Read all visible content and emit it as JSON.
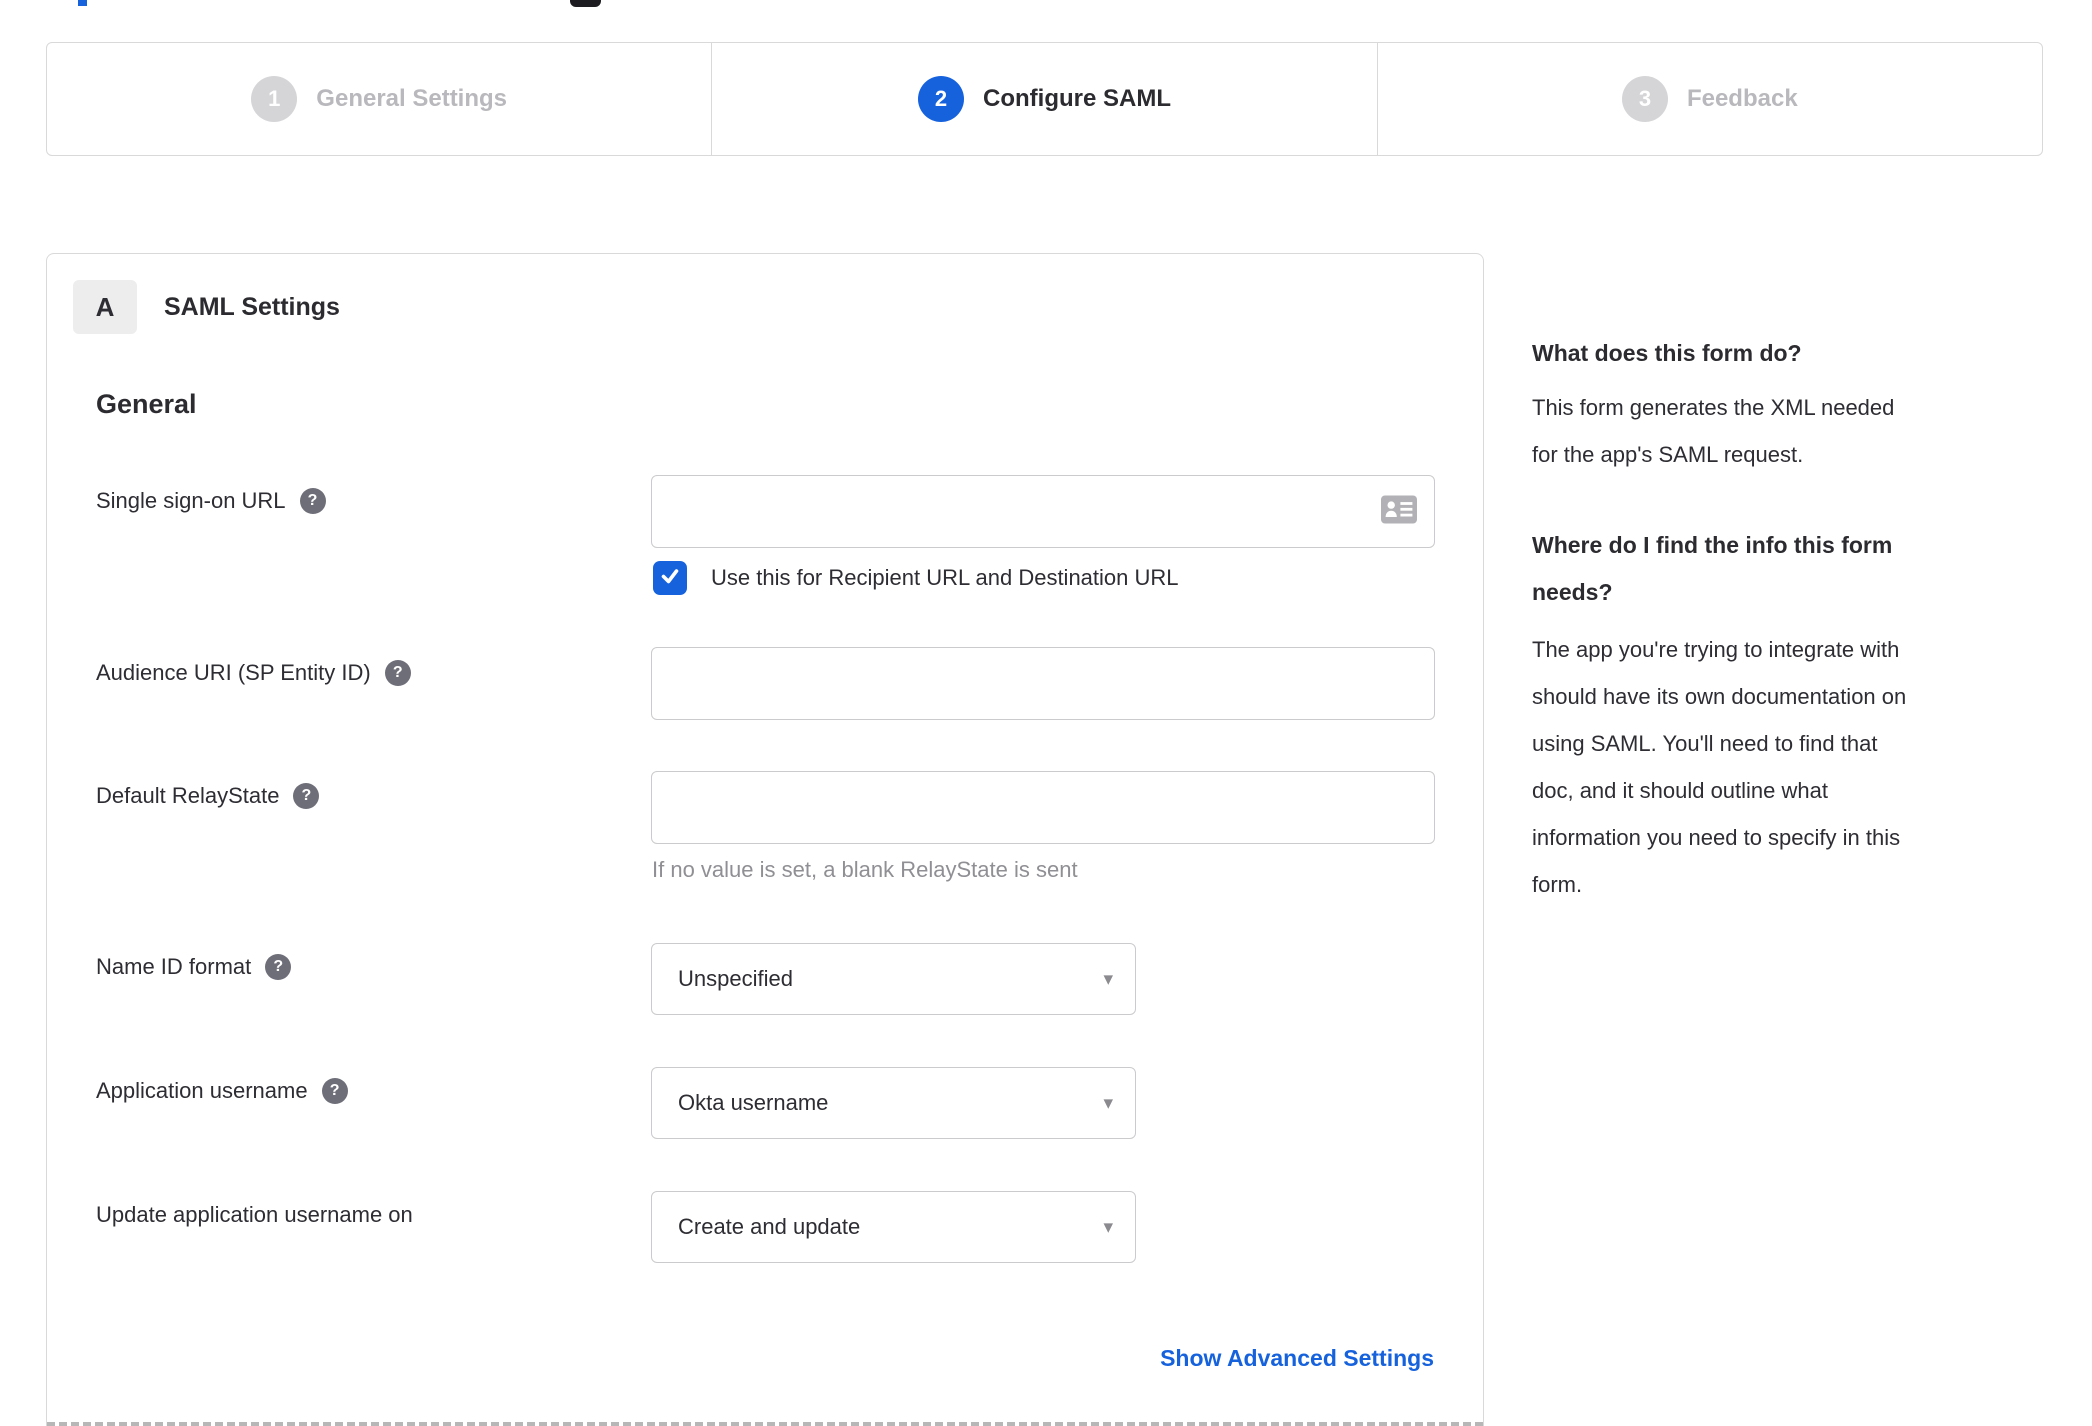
{
  "colors": {
    "accent_blue": "#1662dd",
    "link_blue": "#1662dd",
    "step_inactive_circle": "#d5d5d8",
    "step_inactive_text": "#b9b9bd",
    "border_gray": "#d9d9d9",
    "hint_gray": "#8f8f94",
    "help_icon_bg": "#6e6e78"
  },
  "icons": {
    "help_glyph": "?",
    "caret_glyph": "▾"
  },
  "stepper": {
    "steps": [
      {
        "number": "1",
        "label": "General Settings",
        "state": "inactive"
      },
      {
        "number": "2",
        "label": "Configure SAML",
        "state": "active"
      },
      {
        "number": "3",
        "label": "Feedback",
        "state": "inactive"
      }
    ]
  },
  "panel": {
    "section_letter": "A",
    "section_title": "SAML Settings",
    "group_heading": "General",
    "fields": {
      "sso": {
        "label": "Single sign-on URL",
        "value": "",
        "checkbox_label": "Use this for Recipient URL and Destination URL",
        "checked": true
      },
      "audience": {
        "label": "Audience URI (SP Entity ID)",
        "value": ""
      },
      "relaystate": {
        "label": "Default RelayState",
        "value": "",
        "hint": "If no value is set, a blank RelayState is sent"
      },
      "nameid": {
        "label": "Name ID format",
        "value": "Unspecified"
      },
      "app_username": {
        "label": "Application username",
        "value": "Okta username"
      },
      "update_username": {
        "label": "Update application username on",
        "value": "Create and update"
      }
    },
    "advanced_link": "Show Advanced Settings"
  },
  "sidebar": {
    "q1": {
      "heading": "What does this form do?",
      "body_lines": [
        "This form generates the XML needed",
        "for the app's SAML request."
      ]
    },
    "q2": {
      "heading_lines": [
        "Where do I find the info this form",
        "needs?"
      ],
      "body_lines": [
        "The app you're trying to integrate with",
        "should have its own documentation on",
        "using SAML. You'll need to find that",
        "doc, and it should outline what",
        "information you need to specify in this",
        "form."
      ]
    }
  }
}
